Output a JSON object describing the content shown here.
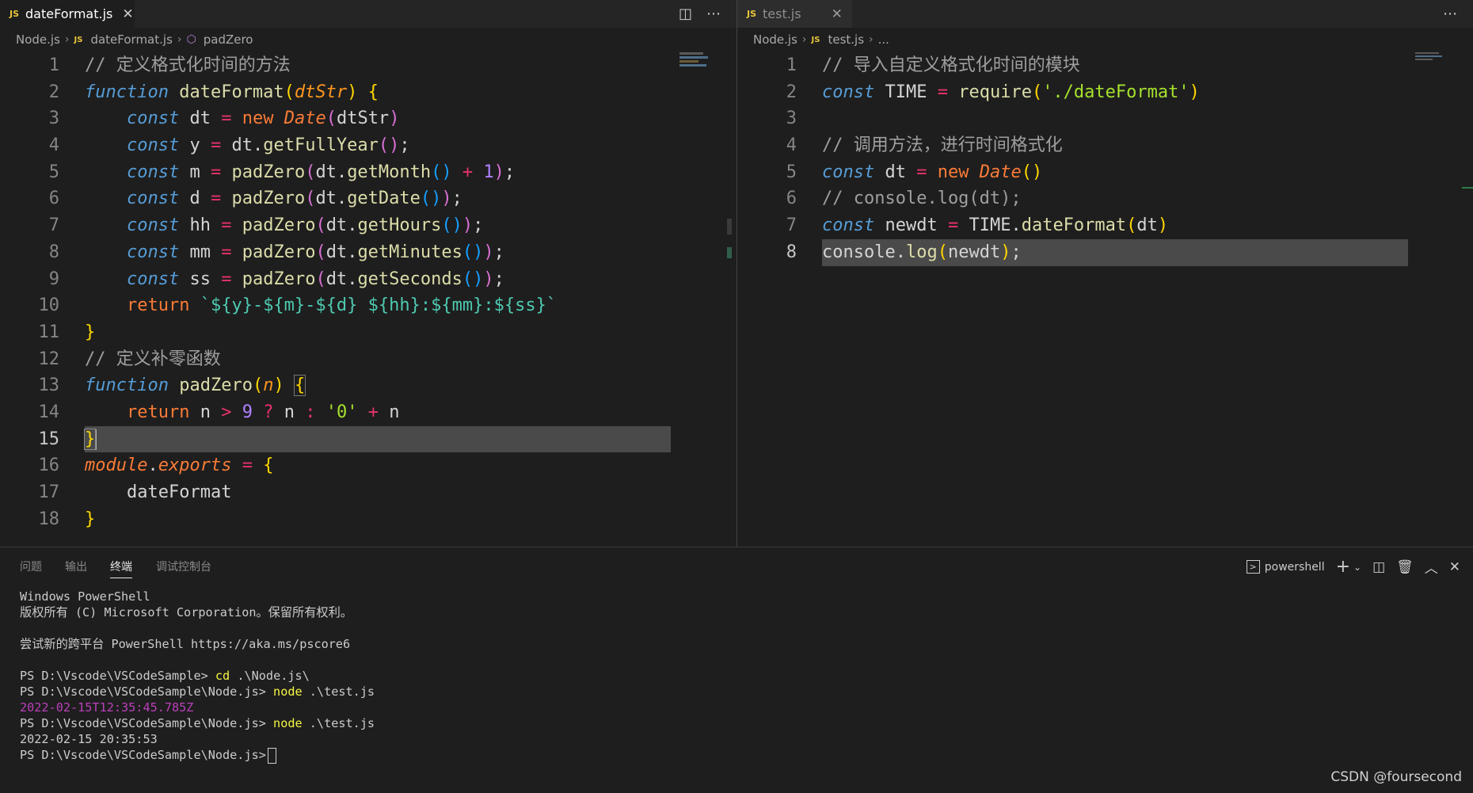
{
  "left_editor": {
    "tab": {
      "icon": "JS",
      "label": "dateFormat.js",
      "close": "✕"
    },
    "breadcrumb": {
      "folder": "Node.js",
      "file_icon": "JS",
      "file": "dateFormat.js",
      "symbol": "padZero"
    },
    "line_numbers": [
      "1",
      "2",
      "3",
      "4",
      "5",
      "6",
      "7",
      "8",
      "9",
      "10",
      "11",
      "12",
      "13",
      "14",
      "15",
      "16",
      "17",
      "18"
    ],
    "current_line": "15",
    "code": {
      "l1_comment": "// 定义格式化时间的方法",
      "kw_function": "function",
      "fn_dateFormat": "dateFormat",
      "param_dtStr": "dtStr",
      "kw_const": "const",
      "kw_new": "new",
      "cls_Date": "Date",
      "v_dtStr": "dtStr",
      "v_dt": "dt",
      "v_y": "y",
      "v_m": "m",
      "v_d": "d",
      "v_hh": "hh",
      "v_mm": "mm",
      "v_ss": "ss",
      "fn_getFullYear": "getFullYear",
      "fn_padZero": "padZero",
      "fn_getMonth": "getMonth",
      "fn_getDate": "getDate",
      "fn_getHours": "getHours",
      "fn_getMinutes": "getMinutes",
      "fn_getSeconds": "getSeconds",
      "num_1": "1",
      "kw_return": "return",
      "template": "`${y}-${m}-${d} ${hh}:${mm}:${ss}`",
      "l12_comment": "// 定义补零函数",
      "param_n": "n",
      "v_n": "n",
      "num_9": "9",
      "str_0": "'0'",
      "kw_module": "module",
      "kw_exports": "exports",
      "prop_dateFormat": "dateFormat"
    }
  },
  "right_editor": {
    "tab": {
      "icon": "JS",
      "label": "test.js",
      "close": "✕"
    },
    "breadcrumb": {
      "folder": "Node.js",
      "file_icon": "JS",
      "file": "test.js",
      "symbol": "..."
    },
    "line_numbers": [
      "1",
      "2",
      "3",
      "4",
      "5",
      "6",
      "7",
      "8"
    ],
    "current_line": "8",
    "code": {
      "l1_comment": "// 导入自定义格式化时间的模块",
      "kw_const": "const",
      "v_TIME": "TIME",
      "fn_require": "require",
      "str_path": "'./dateFormat'",
      "l4_comment": "// 调用方法，进行时间格式化",
      "v_dt": "dt",
      "kw_new": "new",
      "cls_Date": "Date",
      "l6_comment": "// console.log(dt);",
      "v_newdt": "newdt",
      "fn_dateFormat": "dateFormat",
      "v_console": "console",
      "fn_log": "log"
    }
  },
  "panel": {
    "tabs": [
      "问题",
      "输出",
      "终端",
      "调试控制台"
    ],
    "active_tab": "终端",
    "shell": "powershell",
    "terminal": {
      "l1": "Windows PowerShell",
      "l2": "版权所有 (C) Microsoft Corporation。保留所有权利。",
      "l3": "尝试新的跨平台 PowerShell https://aka.ms/pscore6",
      "prompt": "PS D:\\Vscode\\VSCodeSample>",
      "prompt_node": "PS D:\\Vscode\\VSCodeSample\\Node.js>",
      "cmd_cd": "cd",
      "arg_cd": ".\\Node.js\\",
      "cmd_node": "node",
      "arg_node": ".\\test.js",
      "out_iso": "2022-02-15T12:35:45.785Z",
      "out_fmt": "2022-02-15 20:35:53"
    }
  },
  "watermark": "CSDN @foursecond",
  "colors": {
    "keyword": "#569cd6",
    "function": "#dcdcaa",
    "comment": "#9f9f9f",
    "operator": "#e8326a",
    "number": "#ae81ff",
    "string": "#a6e22e",
    "terminal_cmd": "#f5f543",
    "terminal_iso": "#bc3fbc"
  }
}
